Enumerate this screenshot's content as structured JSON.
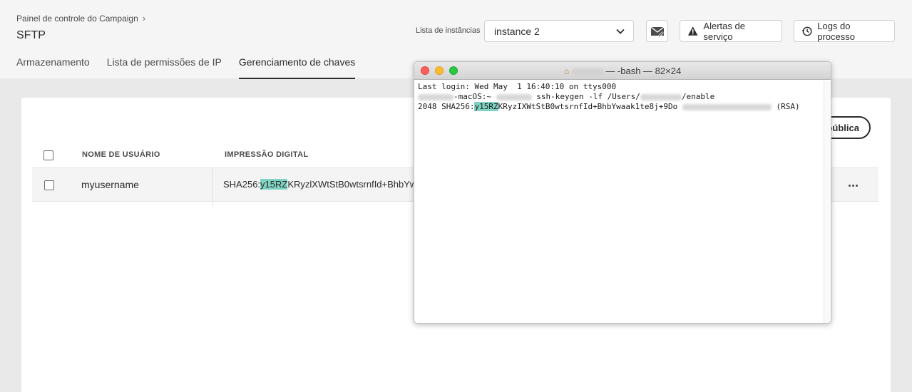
{
  "breadcrumb": {
    "parent": "Painel de controle do Campaign",
    "separator": "›"
  },
  "page": {
    "title": "SFTP"
  },
  "tabs": [
    {
      "label": "Armazenamento",
      "active": false
    },
    {
      "label": "Lista de permissões de IP",
      "active": false
    },
    {
      "label": "Gerenciamento de chaves",
      "active": true
    }
  ],
  "header_controls": {
    "instance_label": "Lista de instâncias",
    "instance_value": "instance 2",
    "alerts_label": "Alertas de serviço",
    "logs_label": "Logs do processo",
    "icons": [
      "mail-block-icon",
      "warning-icon",
      "history-icon",
      "chevron-down-icon"
    ]
  },
  "table": {
    "add_button_label": "pública",
    "columns": [
      "NOME DE USUÁRIO",
      "IMPRESSÃO DIGITAL"
    ],
    "rows": [
      {
        "username": "myusername",
        "fingerprint_prefix": "SHA256:",
        "fingerprint_highlight": "y15RZ",
        "fingerprint_rest": "KRyzlXWtStB0wtsrnfId+BhbYwaa"
      }
    ]
  },
  "terminal": {
    "title_suffix": "— -bash — 82×24",
    "line1": "Last login: Wed May  1 16:40:10 on ttys000",
    "line2_host": "-macOS:~",
    "line2_cmd": " ssh-keygen -lf /Users/",
    "line2_tail": "/enable",
    "line3_prefix": "2048 SHA256:",
    "line3_highlight": "y15RZ",
    "line3_rest": "KRyzIXWtStB0wtsrnfId+BhbYwaak1te8j+9Do ",
    "line3_end": " (RSA)"
  },
  "colors": {
    "highlight": "#7fd3c3",
    "header_bg": "#f5f5f5",
    "page_bg": "#e9e9e9"
  }
}
